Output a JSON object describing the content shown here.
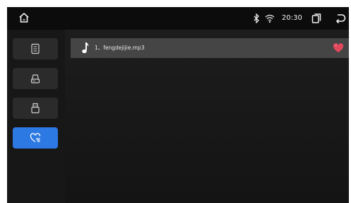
{
  "status_bar": {
    "time": "20:30",
    "icons": [
      "home-icon",
      "bluetooth-icon",
      "wifi-icon",
      "recent-apps-icon",
      "back-icon"
    ]
  },
  "sidebar": {
    "items": [
      {
        "icon": "list-icon",
        "active": false
      },
      {
        "icon": "disc-drive-icon",
        "active": false
      },
      {
        "icon": "usb-icon",
        "active": false
      },
      {
        "icon": "favorites-list-icon",
        "active": true
      }
    ]
  },
  "playlist": {
    "tracks": [
      {
        "title": "1、fengdejijie.mp3",
        "favorite": true
      }
    ]
  },
  "colors": {
    "accent": "#2d79e3",
    "favorite": "#e0485c",
    "row_bg": "#454545",
    "screen_bg": "#141414"
  }
}
